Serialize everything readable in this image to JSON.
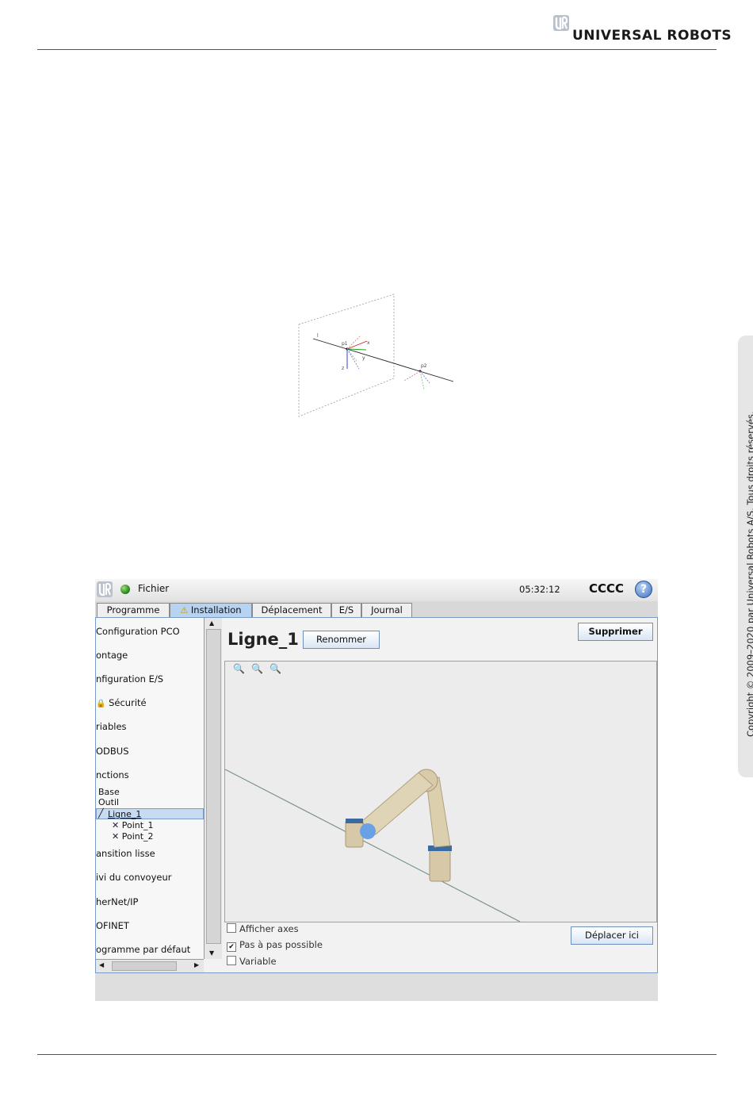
{
  "header": {
    "brand": "UNIVERSAL ROBOTS",
    "logo_icon": "ur-logo-icon"
  },
  "copyright": "Copyright © 2009–2020 par Universal Robots A/S. Tous droits réservés.",
  "diagram": {
    "labels": {
      "line_end": "l",
      "p1": "p1",
      "x": "x",
      "y": "y",
      "z": "z",
      "p2": "p2"
    }
  },
  "screenshot": {
    "topbar": {
      "menu": "Fichier",
      "time": "05:32:12",
      "robot_name": "CCCC",
      "help_icon": "?"
    },
    "tabs": [
      {
        "label": "Programme",
        "active": false
      },
      {
        "label": "Installation",
        "active": true,
        "icon": "warning-icon"
      },
      {
        "label": "Déplacement",
        "active": false
      },
      {
        "label": "E/S",
        "active": false
      },
      {
        "label": "Journal",
        "active": false
      }
    ],
    "nav": {
      "items": [
        "Configuration PCO",
        "ontage",
        "nfiguration E/S",
        "Sécurité",
        "riables",
        "ODBUS",
        "nctions",
        "Base",
        "Outil",
        "Ligne_1",
        "Point_1",
        "Point_2",
        "ansition lisse",
        "ivi du convoyeur",
        "herNet/IP",
        "OFINET",
        "ogramme par défaut"
      ],
      "selected": "Ligne_1"
    },
    "feature": {
      "name": "Ligne_1",
      "rename_button": "Renommer",
      "delete_button": "Supprimer",
      "move_button": "Déplacer ici"
    },
    "options": [
      {
        "label": "Afficher axes",
        "checked": false
      },
      {
        "label": "Pas à pas possible",
        "checked": true
      },
      {
        "label": "Variable",
        "checked": false
      }
    ],
    "colors": {
      "tab_active": "#b7d3f2",
      "frame_border": "#7a9bc4"
    }
  }
}
